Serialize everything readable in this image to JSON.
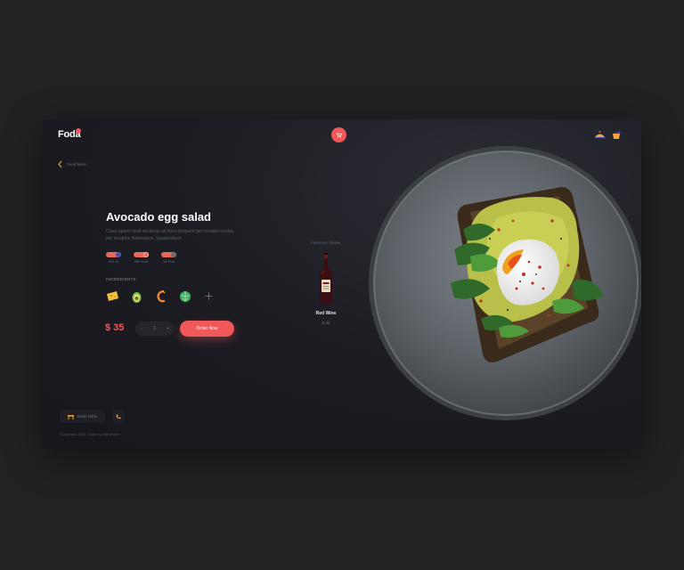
{
  "brand": {
    "name": "Foda"
  },
  "nav": {
    "back_label": "Food Menu"
  },
  "dish": {
    "title": "Avocado egg salad",
    "description": "Class aptent taciti sociosqu ad litora torquent per conubia nostra, per inceptos himenaeos. Suspendisse",
    "nutrition": [
      {
        "label": "250 Gr"
      },
      {
        "label": "350 Kcal"
      },
      {
        "label": "34 Prot"
      }
    ],
    "ingredients_label": "INGREDIENTS",
    "ingredients": [
      {
        "icon": "cheese-icon"
      },
      {
        "icon": "avocado-icon"
      },
      {
        "icon": "shrimp-icon"
      },
      {
        "icon": "cabbage-icon"
      },
      {
        "icon": "plus-icon"
      }
    ],
    "price": "$ 35",
    "quantity": {
      "minus": "-",
      "value": "1",
      "plus": "+"
    },
    "order_label": "Order Now"
  },
  "drink": {
    "label": "PROPER DRINK",
    "name": "Red Wine",
    "price": "$ 35"
  },
  "footer": {
    "book_label": "Book Table",
    "copyright": "©Copyright 2020, Made by ineecframe"
  },
  "colors": {
    "accent": "#f0585a",
    "background": "#222222",
    "card": "#1d1d24"
  }
}
